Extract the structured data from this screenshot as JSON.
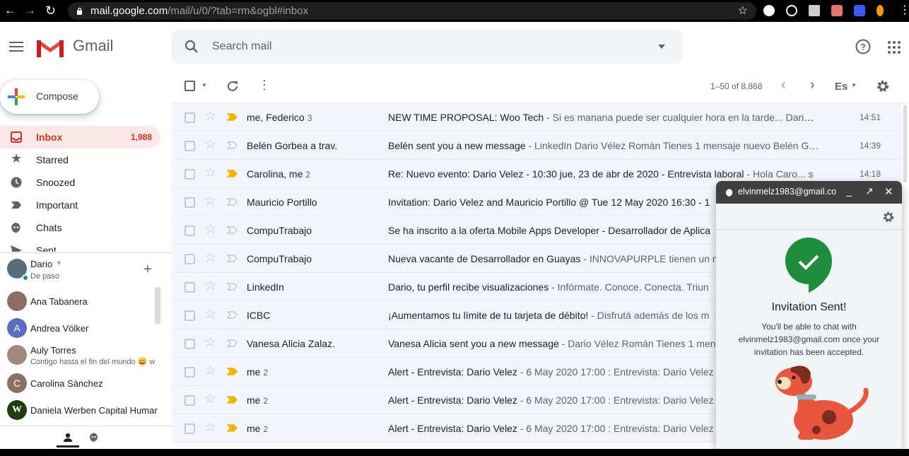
{
  "browser": {
    "url_host": "mail.google.com",
    "url_path": "/mail/u/0/?tab=rm&ogbl#inbox"
  },
  "header": {
    "app_name": "Gmail",
    "search_placeholder": "Search mail"
  },
  "toolbar": {
    "page_info": "1–50 of 8,868",
    "lang_label": "Es"
  },
  "sidebar": {
    "compose_label": "Compose",
    "items": [
      {
        "label": "Inbox",
        "count": "1,988",
        "icon": "inbox-icon"
      },
      {
        "label": "Starred",
        "count": "",
        "icon": "star-icon"
      },
      {
        "label": "Snoozed",
        "count": "",
        "icon": "clock-icon"
      },
      {
        "label": "Important",
        "count": "",
        "icon": "important-icon"
      },
      {
        "label": "Chats",
        "count": "",
        "icon": "chat-icon"
      },
      {
        "label": "Sent",
        "count": "",
        "icon": "send-icon"
      }
    ]
  },
  "hangouts": {
    "user_name": "Dario",
    "user_status": "De paso",
    "contacts": [
      {
        "name": "Ana Tabanera",
        "initial": "",
        "status": "",
        "color": "#8d6e63"
      },
      {
        "name": "Andrea Völker",
        "initial": "A",
        "status": "",
        "color": "#5c6bc0"
      },
      {
        "name": "Auly Torres",
        "initial": "",
        "status": "Contigo hasta el fin del mundo 😄 w",
        "color": "#a1887f"
      },
      {
        "name": "Carolina Sánchez",
        "initial": "C",
        "status": "",
        "color": "#8d6e63"
      },
      {
        "name": "Daniela Werben Capital Humar",
        "initial": "W",
        "status": "",
        "color": "#33691e"
      }
    ]
  },
  "emails": [
    {
      "sender": "me, Federico",
      "count": "3",
      "subject": "NEW TIME PROPOSAL: Woo Tech",
      "snippet": " - Si es manana puede ser cualquier hora en la tarde... Dario …",
      "time": "14:51",
      "important": true
    },
    {
      "sender": "Belén Gorbea a trav.",
      "count": "",
      "subject": "Belén sent you a new message",
      "snippet": " - LinkedIn Dario Vélez Román Tienes 1 mensaje nuevo Belén G…",
      "time": "14:39",
      "important": false
    },
    {
      "sender": "Carolina, me",
      "count": "2",
      "subject": "Re: Nuevo evento: Dario Velez - 10:30 jue, 23 de abr de 2020 - Entrevista laboral",
      "snippet": " - Hola Caro... s",
      "time": "14:18",
      "important": true
    },
    {
      "sender": "Mauricio Portillo",
      "count": "",
      "subject": "Invitation: Dario Velez and Mauricio Portillo @ Tue 12 May 2020 16:30 - 1",
      "snippet": "",
      "time": "",
      "important": false
    },
    {
      "sender": "CompuTrabajo",
      "count": "",
      "subject": "Se ha inscrito a la oferta Mobile Apps Developer - Desarrollador de Aplica",
      "snippet": "",
      "time": "",
      "important": false
    },
    {
      "sender": "CompuTrabajo",
      "count": "",
      "subject": "Nueva vacante de Desarrollador en Guayas",
      "snippet": " - INNOVAPURPLE tienen un nu",
      "time": "",
      "important": false
    },
    {
      "sender": "LinkedIn",
      "count": "",
      "subject": "Dario, tu perfil recibe visualizaciones",
      "snippet": " - Infórmate. Conoce. Conecta. Triun",
      "time": "",
      "important": false
    },
    {
      "sender": "ICBC",
      "count": "",
      "subject": "¡Aumentamos tu límite de tu tarjeta de débito!",
      "snippet": " - Disfrutá además de los m",
      "time": "",
      "important": false
    },
    {
      "sender": "Vanesa Alicia Zalaz.",
      "count": "",
      "subject": "Vanesa Alicia sent you a new message",
      "snippet": " - Dario Vélez Román Tienes 1 men",
      "time": "",
      "important": false
    },
    {
      "sender": "me",
      "count": "2",
      "subject": "Alert - Entrevista: Dario Velez",
      "snippet": " - 6 May 2020 17:00 : Entrevista: Dario Velez",
      "time": "",
      "important": true
    },
    {
      "sender": "me",
      "count": "2",
      "subject": "Alert - Entrevista: Dario Velez",
      "snippet": " - 6 May 2020 17:00 : Entrevista: Dario Velez",
      "time": "",
      "important": true
    },
    {
      "sender": "me",
      "count": "2",
      "subject": "Alert - Entrevista: Dario Velez",
      "snippet": " - 6 May 2020 17:00 : Entrevista: Dario Velez",
      "time": "",
      "important": true
    }
  ],
  "chat": {
    "email": "elvinmelz1983@gmail.com",
    "title": "Invitation Sent!",
    "message": "You'll be able to chat with elvinmelz1983@gmail.com once your invitation has been accepted."
  },
  "colors": {
    "accent_red": "#d93025",
    "important_yellow": "#f4b400",
    "chat_green": "#1e8e3e"
  }
}
